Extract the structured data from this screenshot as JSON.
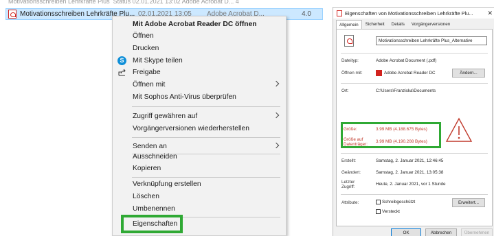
{
  "explorer": {
    "ghost_row": "Motivationsschreiben Lehrkräfte Plus_Status     02.01.2021 13:02     Adobe Acrobat D...     4",
    "selected_file": {
      "name": "Motivationsschreiben Lehrkräfte Plu...",
      "date": "02.01.2021 13:05",
      "type": "Adobe Acrobat D...",
      "size": "4.0"
    }
  },
  "context_menu": {
    "items": [
      "Mit Adobe Acrobat Reader DC öffnen",
      "Öffnen",
      "Drucken",
      "Mit Skype teilen",
      "Freigabe",
      "Öffnen mit",
      "Mit Sophos Anti-Virus überprüfen",
      "Zugriff gewähren auf",
      "Vorgängerversionen wiederherstellen",
      "Senden an",
      "Ausschneiden",
      "Kopieren",
      "Verknüpfung erstellen",
      "Löschen",
      "Umbenennen",
      "Eigenschaften"
    ],
    "skype_glyph": "S",
    "highlight_color": "#2fa934"
  },
  "properties": {
    "title": "Eigenschaften von Motivationsschreiben Lehrkräfte Plu...",
    "close_glyph": "✕",
    "tabs": [
      "Allgemein",
      "Sicherheit",
      "Details",
      "Vorgängerversionen"
    ],
    "file_name": "Motivationsschreiben Lehrkräfte Plus_Alternative",
    "labels": {
      "type": "Dateityp:",
      "opens_with": "Öffnen mit:",
      "location": "Ort:",
      "size": "Größe:",
      "size_on_disk_1": "Größe auf",
      "size_on_disk_2": "Datenträger:",
      "created": "Erstellt:",
      "modified": "Geändert:",
      "accessed_1": "Letzter",
      "accessed_2": "Zugriff:",
      "attributes": "Attribute:"
    },
    "values": {
      "type": "Adobe Acrobat Document (.pdf)",
      "opens_with": "Adobe Acrobat Reader DC",
      "location": "C:\\Users\\Franziska\\Documents",
      "size": "3.99 MB (4.188.675 Bytes)",
      "size_on_disk": "3.99 MB (4.190.208 Bytes)",
      "created": "Samstag, 2. Januar 2021, 12:46:45",
      "modified": "Samstag, 2. Januar 2021, 13:05:38",
      "accessed": "Heute, 2. Januar 2021, vor 1 Stunde"
    },
    "buttons": {
      "change": "Ändern...",
      "advanced": "Erweitert...",
      "ok": "OK",
      "cancel": "Abbrechen",
      "apply": "Übernehmen"
    },
    "attributes": {
      "readonly": "Schreibgeschützt",
      "hidden": "Versteckt"
    },
    "warning_color": "#c0392b"
  }
}
